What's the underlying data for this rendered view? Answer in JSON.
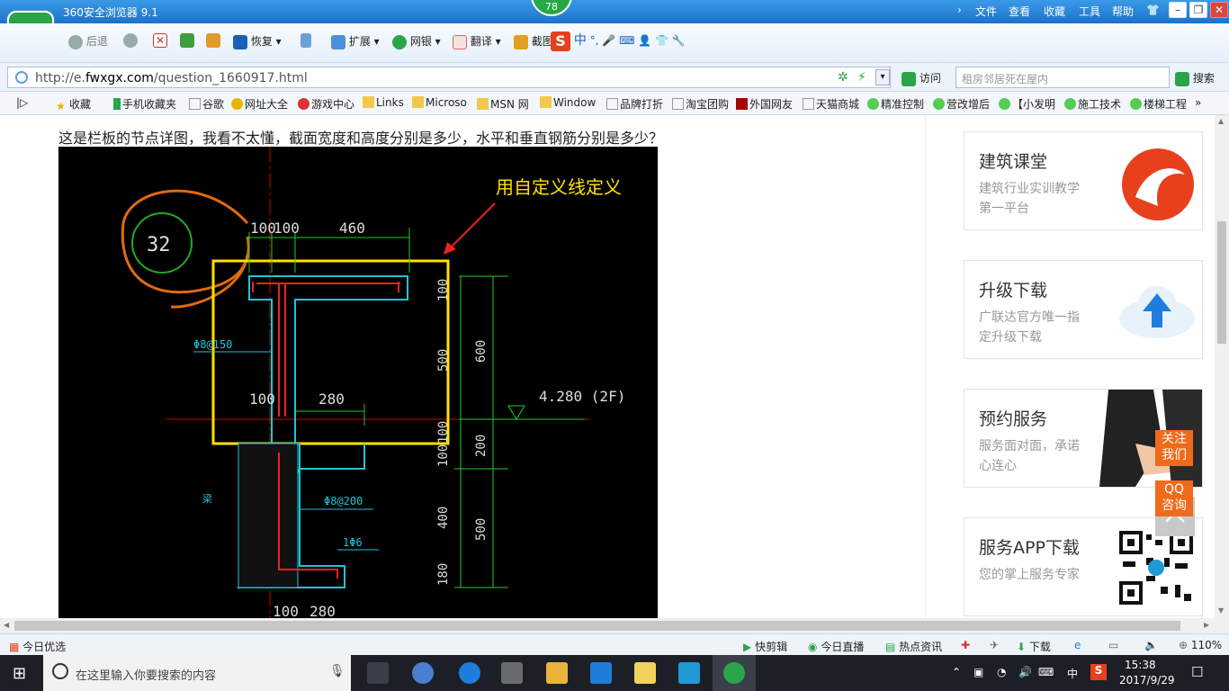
{
  "window": {
    "title": "360安全浏览器 9.1",
    "badge": "78",
    "menu": [
      "文件",
      "查看",
      "收藏",
      "工具",
      "帮助"
    ]
  },
  "toolbar": {
    "back": "后退",
    "restore": "恢复",
    "extend": "扩展",
    "bank": "网银",
    "translate": "翻译",
    "screenshot": "截图",
    "ime_cn": "中",
    "ime_punct": "°,",
    "visit": "访问",
    "search_btn": "搜索"
  },
  "address": {
    "url_prefix": "http://e.",
    "url_domain": "fwxgx.com",
    "url_path": "/question_1660917.html",
    "search_placeholder": "租房邻居死在屋内"
  },
  "favorites": [
    "收藏",
    "手机收藏夹",
    "谷歌",
    "网址大全",
    "游戏中心",
    "Links",
    "Microso",
    "MSN 网",
    "Window",
    "品牌打折",
    "淘宝团购",
    "外国网友",
    "天猫商城",
    "精准控制",
    "营改增后",
    "【小发明",
    "施工技术",
    "楼梯工程"
  ],
  "page": {
    "question": "这是栏板的节点详图，我看不太懂，截面宽度和高度分别是多少，水平和垂直钢筋分别是多少？"
  },
  "cad": {
    "annotation": "用自定义线定义",
    "circle_label": "32",
    "dims_top": [
      "100",
      "100",
      "460"
    ],
    "dim_280": "280",
    "dim_100_mid": "100",
    "dims_right": [
      "100",
      "500",
      "600",
      "100",
      "100",
      "200",
      "400",
      "500",
      "180"
    ],
    "elevation": "4.280 (2F)",
    "rebar1": "Φ8@150",
    "rebar2": "Φ8@200",
    "rebar3": "1Φ6",
    "side_label": "梁",
    "dims_bottom": [
      "100",
      "280"
    ]
  },
  "sidebar": {
    "cards": [
      {
        "title": "建筑课堂",
        "sub": "建筑行业实训教学第一平台"
      },
      {
        "title": "升级下载",
        "sub": "广联达官方唯一指定升级下载"
      },
      {
        "title": "预约服务",
        "sub": "服务面对面，承诺心连心"
      },
      {
        "title": "服务APP下载",
        "sub": "您的掌上服务专家"
      }
    ],
    "follow": "关注我们",
    "qq": "QQ咨询"
  },
  "statusbar": {
    "left": "今日优选",
    "items": [
      "快剪辑",
      "今日直播",
      "热点资讯",
      "下载"
    ],
    "zoom": "110%"
  },
  "taskbar": {
    "search_placeholder": "在这里输入你要搜索的内容",
    "ime": "中",
    "time": "15:38",
    "date": "2017/9/29"
  }
}
